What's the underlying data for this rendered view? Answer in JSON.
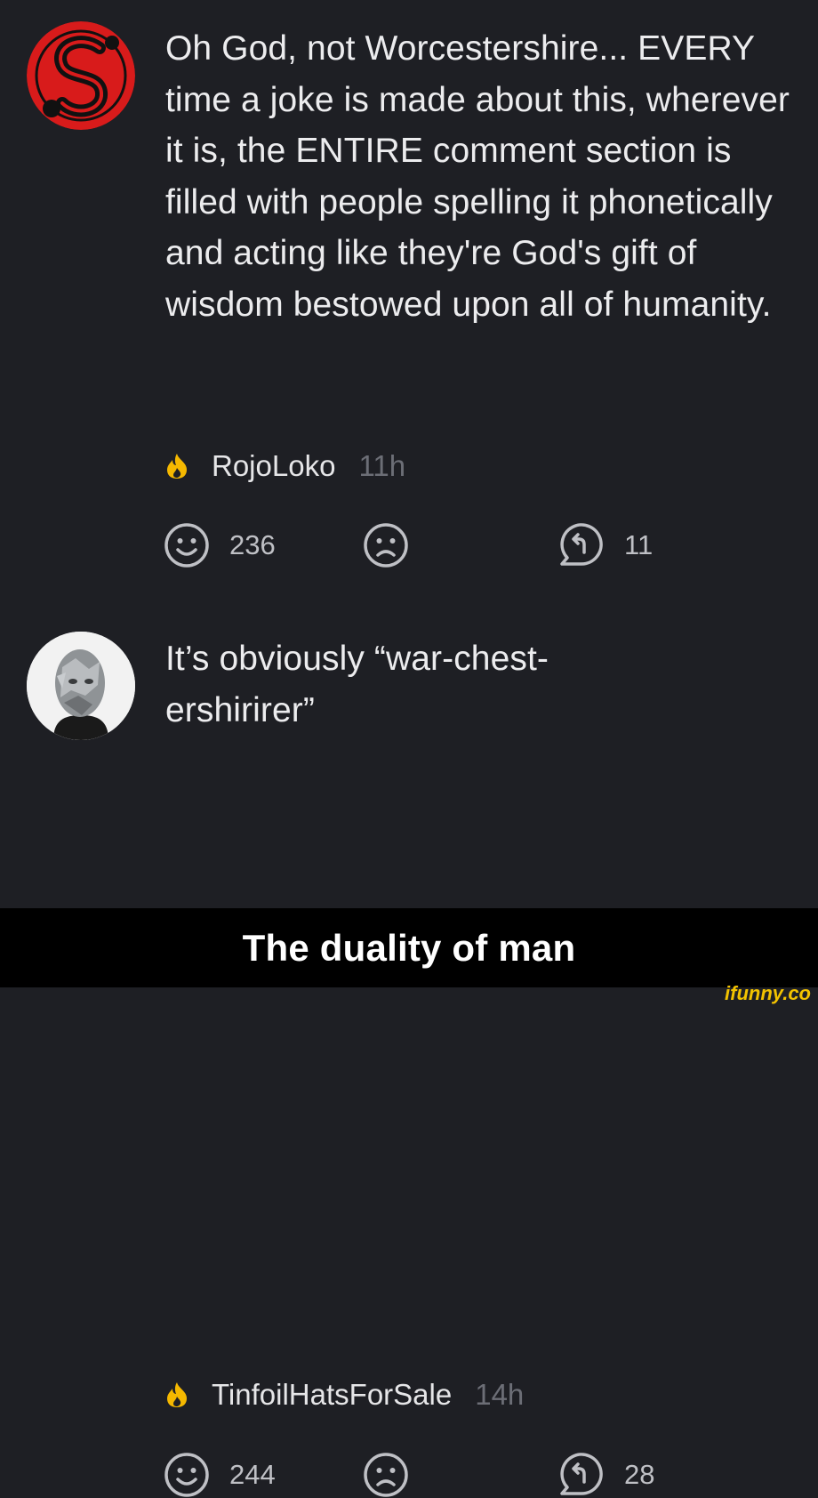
{
  "comments": [
    {
      "text": "Oh God, not Worcestershire... EVERY time a joke is made about this, wherever it is, the ENTIRE comment section is filled with people spelling it phonetically and acting like they're God's gift of wisdom bestowed upon all of humanity.",
      "author": "RojoLoko",
      "time": "11h",
      "likes": "236",
      "replies": "11"
    },
    {
      "text": "It’s obviously “war-chest-ershirirer”",
      "author": "TinfoilHatsForSale",
      "time": "14h",
      "likes": "244",
      "replies": "28"
    }
  ],
  "caption": "The duality of man",
  "watermark": "ifunny.co",
  "colors": {
    "background": "#1e1f24",
    "flame": "#f5b800",
    "icon": "#bfc0c5",
    "time": "#6c6e76",
    "watermark": "#f2c200"
  }
}
